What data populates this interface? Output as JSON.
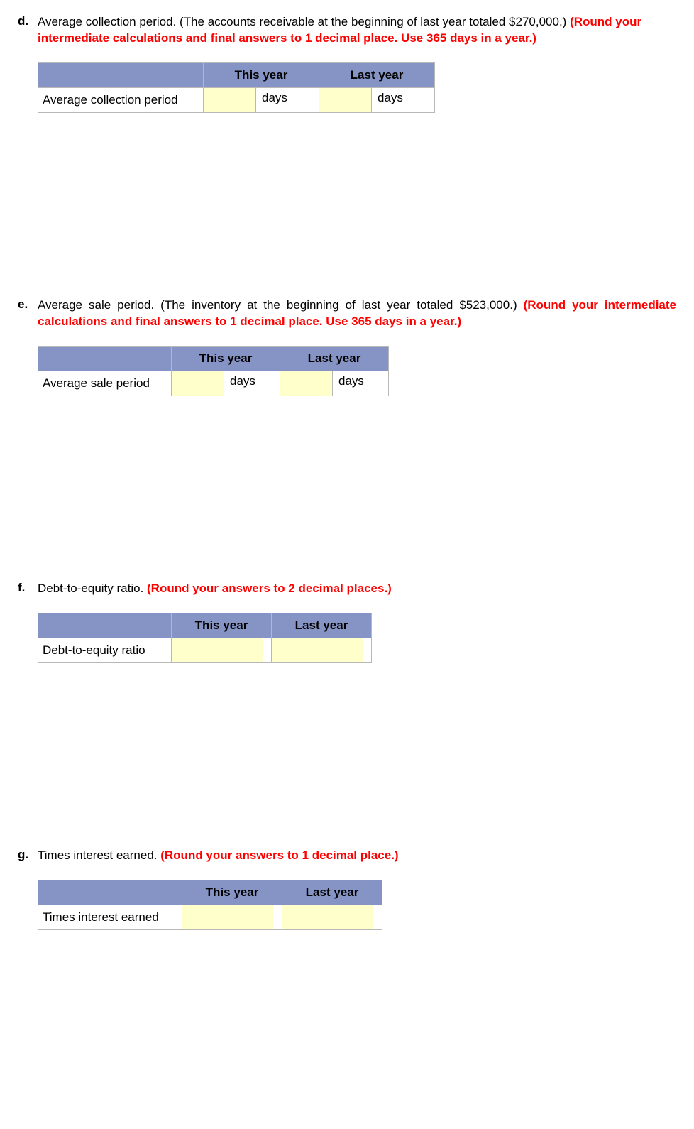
{
  "questions": {
    "d": {
      "letter": "d.",
      "text": "Average collection period. (The accounts receivable at the beginning of last year totaled $270,000.) ",
      "instruction": "(Round your intermediate calculations and final answers to 1 decimal place. Use 365 days in a year.)",
      "row_label": "Average collection period",
      "col_this": "This year",
      "col_last": "Last year",
      "unit": "days"
    },
    "e": {
      "letter": "e.",
      "text": "Average sale period. (The inventory at the beginning of last year totaled $523,000.) ",
      "instruction": "(Round your intermediate calculations and final answers to 1 decimal place. Use 365 days in a year.)",
      "row_label": "Average sale period",
      "col_this": "This year",
      "col_last": "Last year",
      "unit": "days"
    },
    "f": {
      "letter": "f.",
      "text": "Debt-to-equity ratio. ",
      "instruction": "(Round your answers to 2 decimal places.)",
      "row_label": "Debt-to-equity ratio",
      "col_this": "This year",
      "col_last": "Last year"
    },
    "g": {
      "letter": "g.",
      "text": "Times interest earned. ",
      "instruction": "(Round your answers to 1 decimal place.)",
      "row_label": "Times interest earned",
      "col_this": "This year",
      "col_last": "Last year"
    }
  }
}
